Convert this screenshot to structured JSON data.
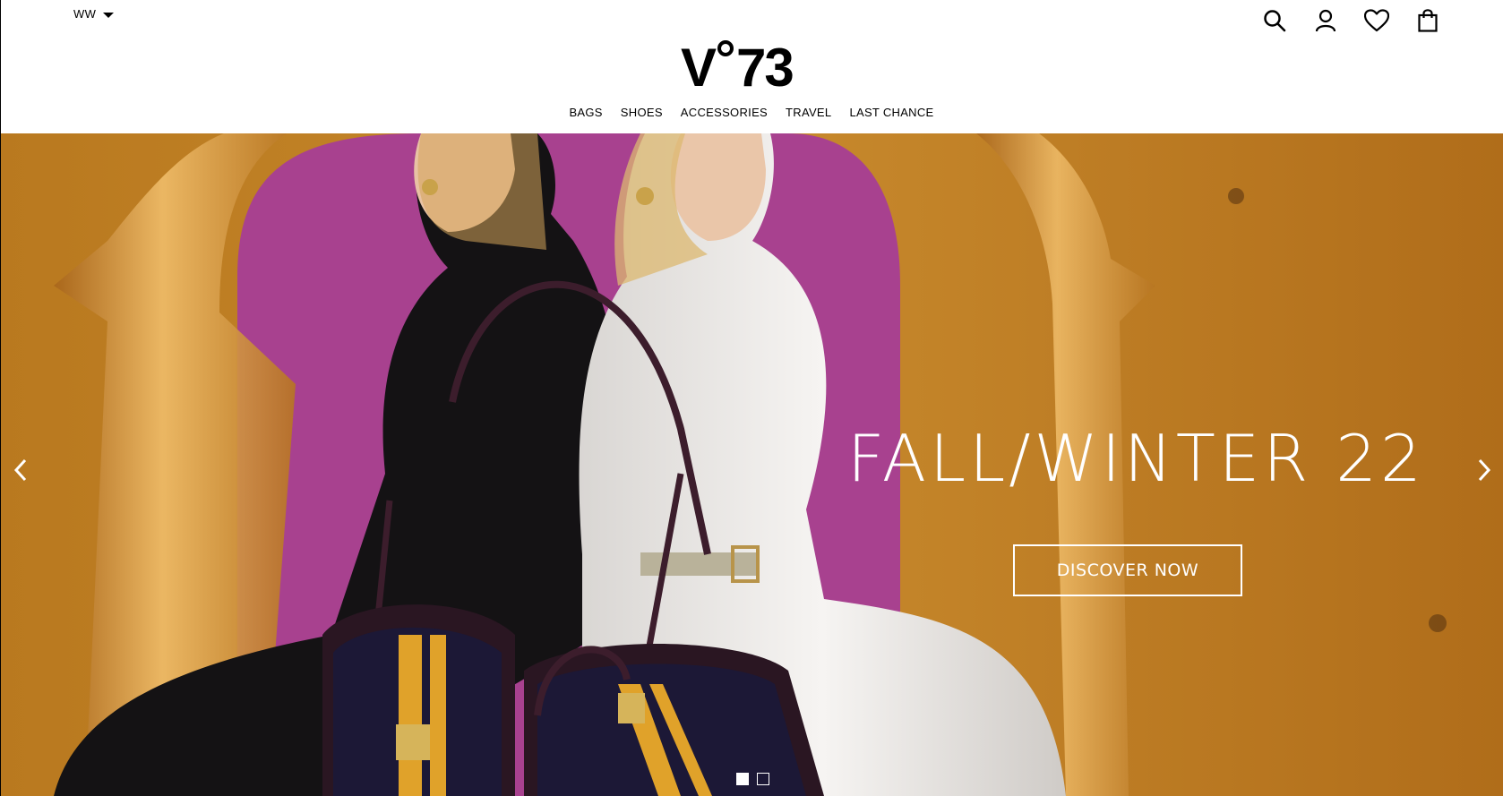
{
  "header": {
    "locale": "WW",
    "logo": "V°73",
    "icons": [
      "search-icon",
      "account-icon",
      "wishlist-heart-icon",
      "shopping-bag-icon"
    ]
  },
  "nav": {
    "items": [
      "BAGS",
      "SHOES",
      "ACCESSORIES",
      "TRAVEL",
      "LAST CHANCE"
    ]
  },
  "hero": {
    "headline": "FALL/WINTER 22",
    "cta_label": "DISCOVER NOW",
    "slide_count": 2,
    "active_slide": 1,
    "colors": {
      "wall": "#c0832c",
      "backdrop": "#a8418f",
      "text": "#ffffff"
    }
  }
}
